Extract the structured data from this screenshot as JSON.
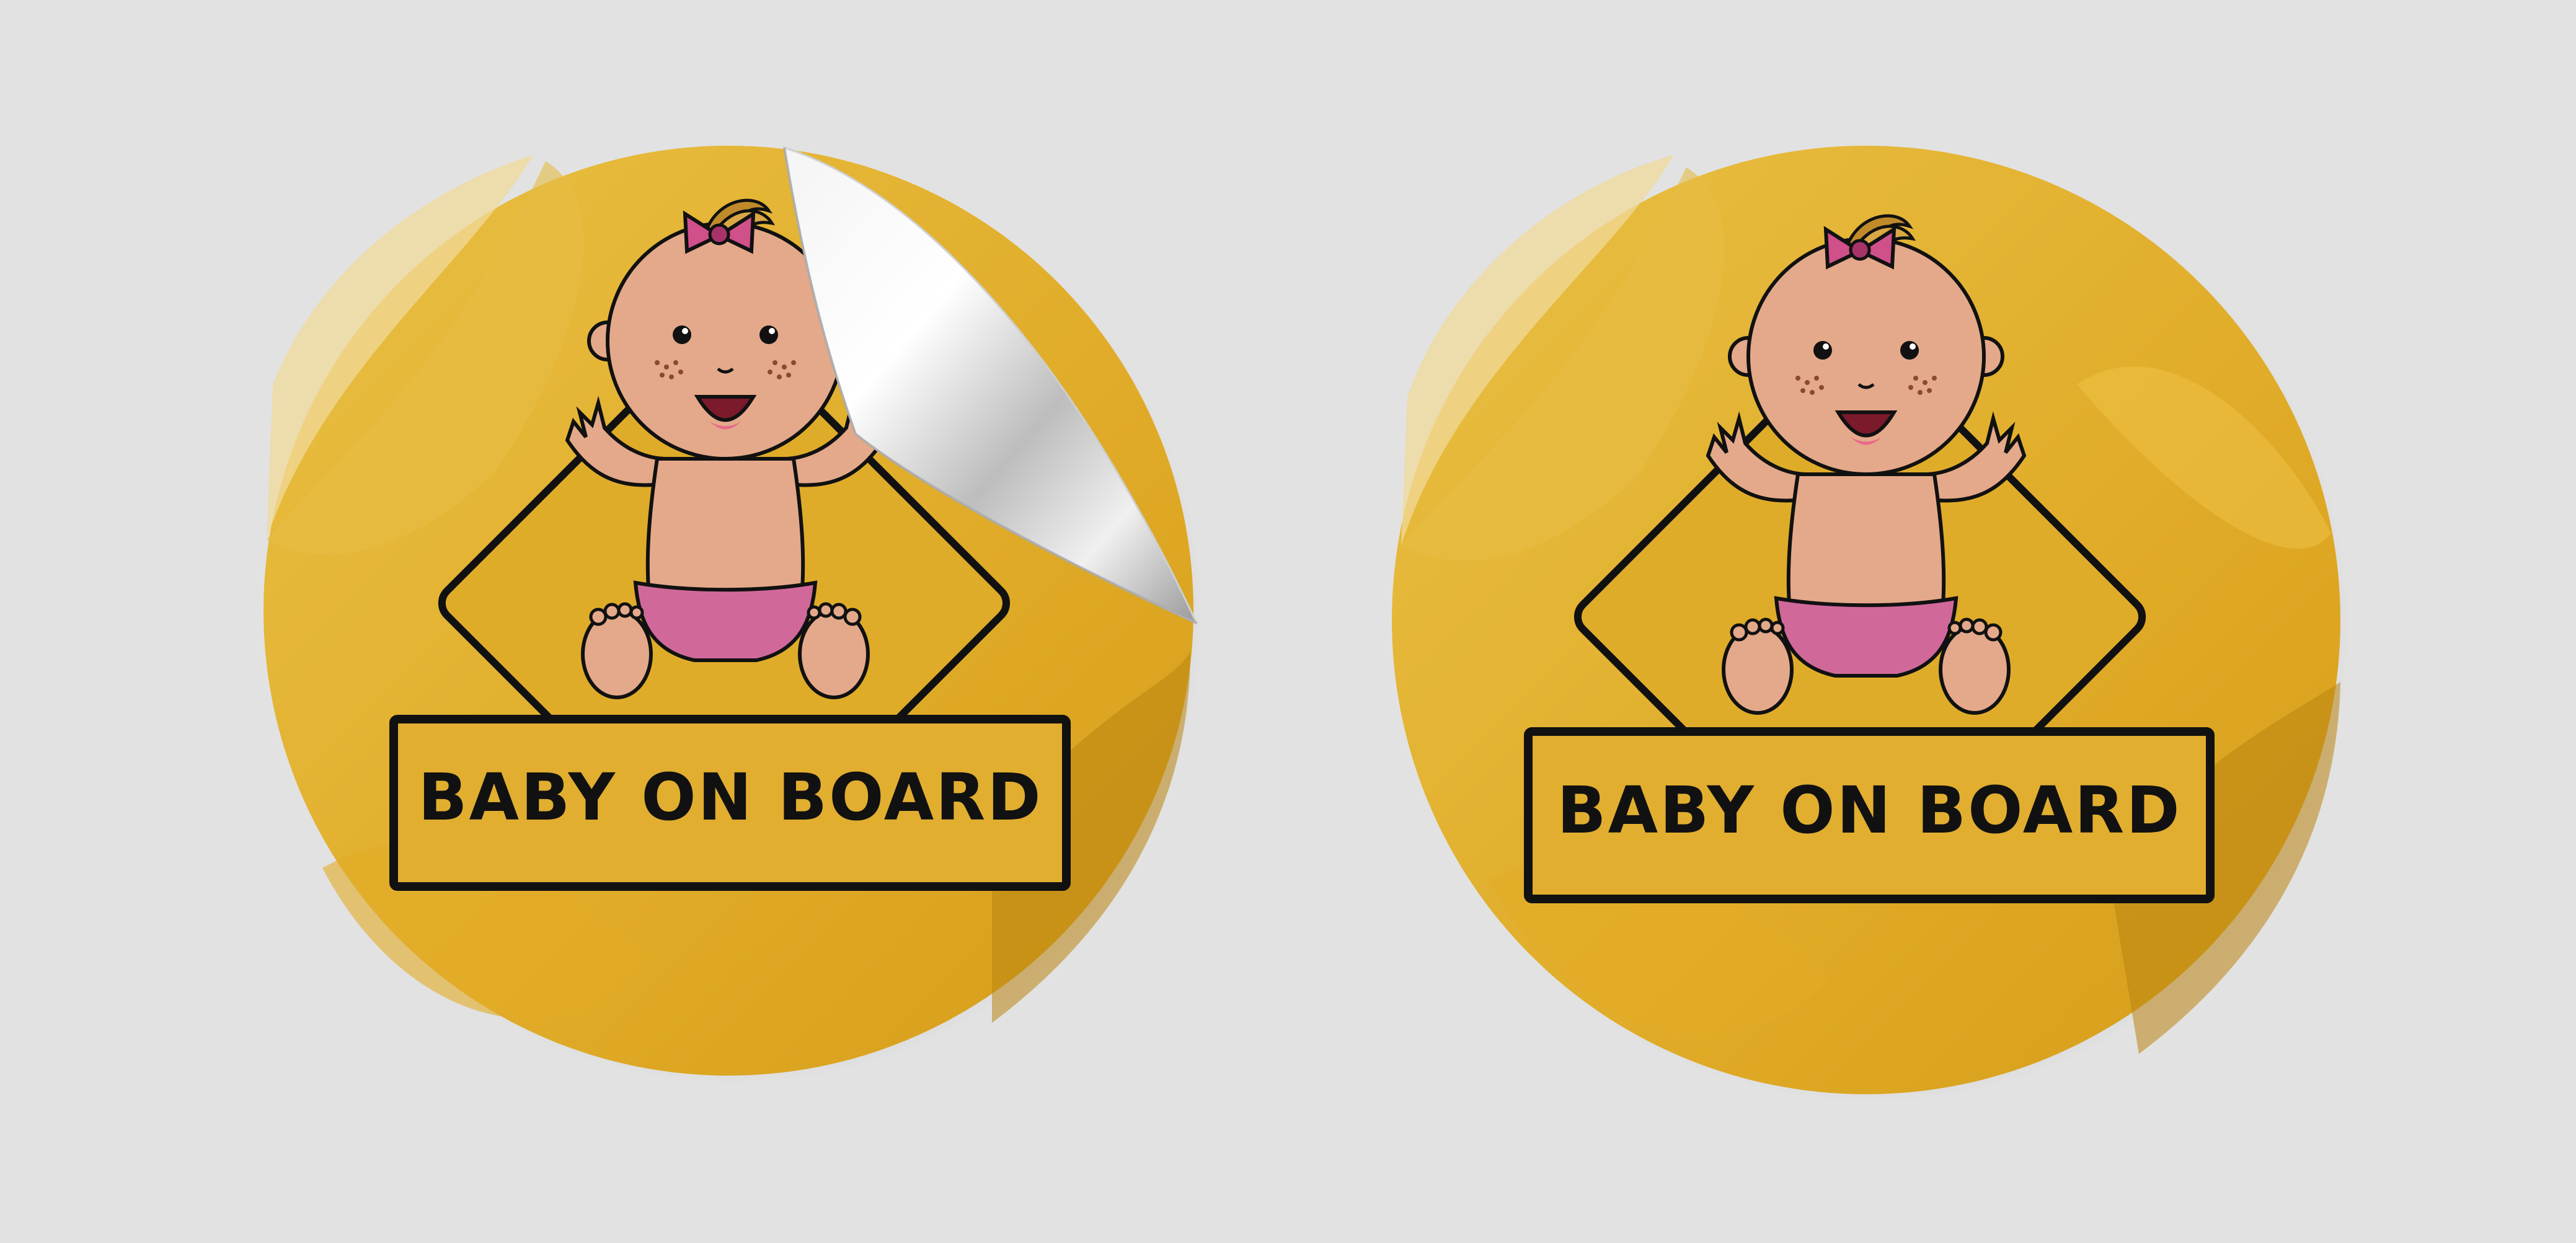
{
  "scene": {
    "background": "#e2e2e2",
    "description_items": [
      "sticker-peeled",
      "sticker-flat"
    ]
  },
  "stickers": [
    {
      "label": "BABY ON BOARD",
      "state": "corner-peeled"
    },
    {
      "label": "BABY ON BOARD",
      "state": "flat"
    }
  ],
  "colors": {
    "sticker_yellow": "#e3b030",
    "sticker_yellow_dark": "#c99018",
    "sticker_yellow_light": "#f1d88a",
    "sign_yellow": "#dfac2a",
    "outline": "#111111",
    "skin": "#e4a98a",
    "diaper": "#d0699a",
    "bow": "#d0508a",
    "hair": "#c08a2a",
    "peel_silver": "#e8e8e8"
  }
}
